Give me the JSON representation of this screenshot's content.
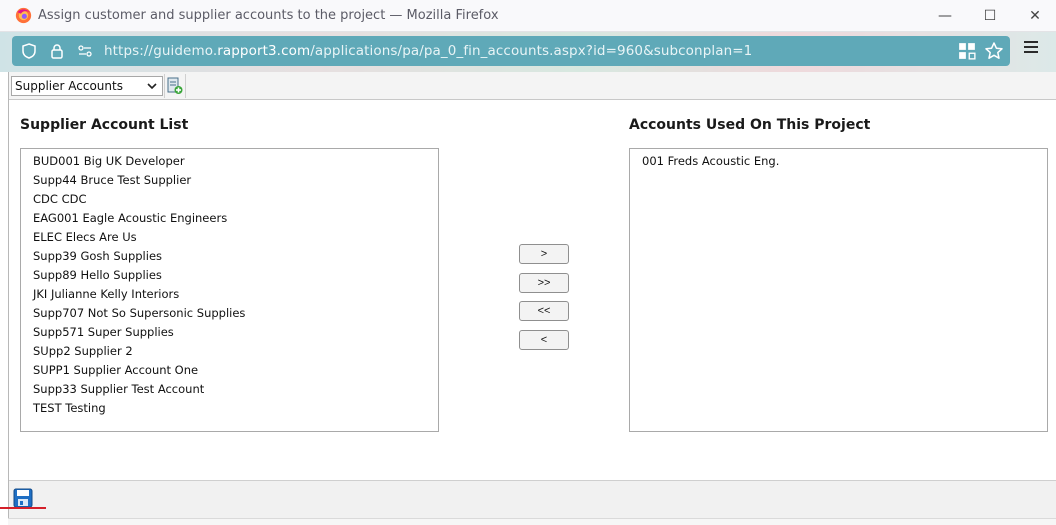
{
  "window": {
    "title": "Assign customer and supplier accounts to the project — Mozilla Firefox",
    "minimize_glyph": "—",
    "maximize_glyph": "☐",
    "close_glyph": "✕"
  },
  "address_bar": {
    "url_prefix": "https://guidemo.",
    "url_domain": "rapport3.com",
    "url_path": "/applications/pa/pa_0_fin_accounts.aspx?id=960&subconplan=1"
  },
  "toolbar": {
    "account_type_select": "Supplier Accounts"
  },
  "left_panel": {
    "title": "Supplier Account List",
    "items": [
      "BUD001 Big UK Developer",
      "Supp44 Bruce Test Supplier",
      "CDC CDC",
      "EAG001 Eagle Acoustic Engineers",
      "ELEC Elecs Are Us",
      "Supp39 Gosh Supplies",
      "Supp89 Hello Supplies",
      "JKI Julianne Kelly Interiors",
      "Supp707 Not So Supersonic Supplies",
      "Supp571 Super Supplies",
      "SUpp2 Supplier 2",
      "SUPP1 Supplier Account One",
      "Supp33 Supplier Test Account",
      "TEST Testing"
    ]
  },
  "right_panel": {
    "title": "Accounts Used On This Project",
    "items": [
      "001 Freds Acoustic Eng."
    ]
  },
  "move_buttons": {
    "add_one": ">",
    "add_all": ">>",
    "remove_all": "<<",
    "remove_one": "<"
  },
  "icons": {
    "firefox": "firefox-logo-icon",
    "shield": "tracking-shield-icon",
    "lock": "lock-icon",
    "permissions": "permissions-icon",
    "qr": "qr-code-icon",
    "star": "bookmark-star-icon",
    "menu": "hamburger-menu-icon",
    "add": "add-account-icon",
    "save": "save-icon"
  },
  "colors": {
    "url_bar": "#5fa9b8",
    "save_underline": "#d4202a"
  }
}
